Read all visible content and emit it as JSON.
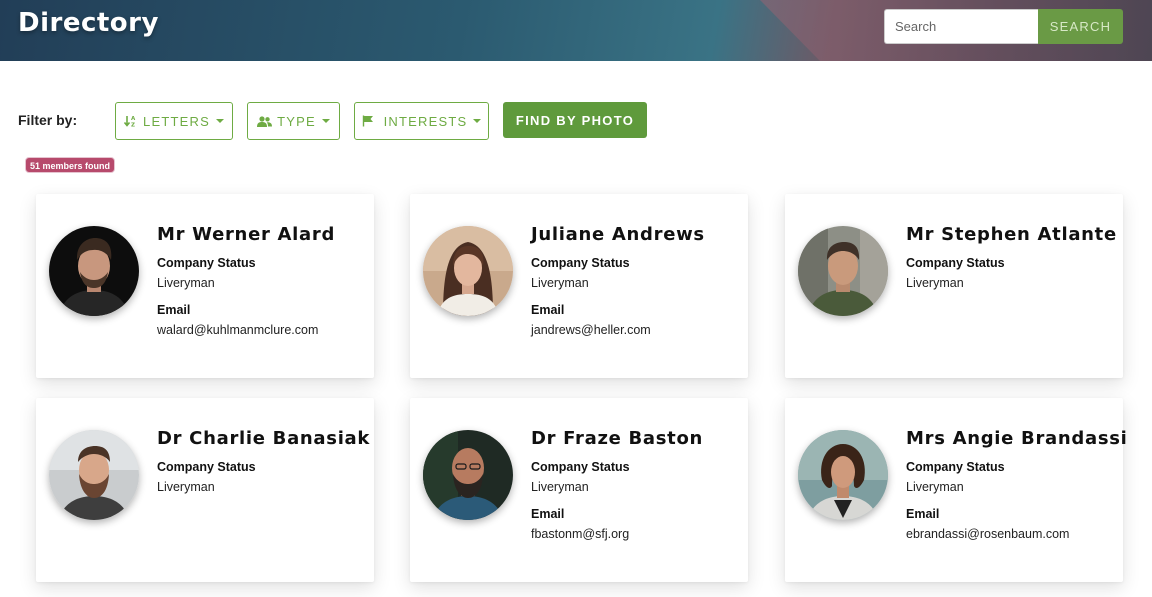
{
  "header": {
    "title": "Directory",
    "search_placeholder": "Search",
    "search_button": "SEARCH"
  },
  "filters": {
    "label": "Filter by:",
    "letters": "LETTERS",
    "type": "TYPE",
    "interests": "INTERESTS",
    "find_by_photo": "FIND BY PHOTO",
    "count": "51 members found"
  },
  "colors": {
    "accent_green": "#6eab43",
    "badge_pink": "#b74a6c"
  },
  "members": [
    {
      "name": "Mr Werner Alard",
      "status_label": "Company Status",
      "status": "Liveryman",
      "email_label": "Email",
      "email": "walard@kuhlmanmclure.com",
      "avatar": "man-beard-dark-bg"
    },
    {
      "name": "Juliane Andrews",
      "status_label": "Company Status",
      "status": "Liveryman",
      "email_label": "Email",
      "email": "jandrews@heller.com",
      "avatar": "woman-long-hair"
    },
    {
      "name": "Mr Stephen Atlante",
      "status_label": "Company Status",
      "status": "Liveryman",
      "avatar": "man-short-hair"
    },
    {
      "name": "Dr Charlie Banasiak",
      "status_label": "Company Status",
      "status": "Liveryman",
      "avatar": "man-beard-light-bg"
    },
    {
      "name": "Dr Fraze Baston",
      "status_label": "Company Status",
      "status": "Liveryman",
      "email_label": "Email",
      "email": "fbastonm@sfj.org",
      "avatar": "man-bald-beard"
    },
    {
      "name": "Mrs Angie Brandassi",
      "status_label": "Company Status",
      "status": "Liveryman",
      "email_label": "Email",
      "email": "ebrandassi@rosenbaum.com",
      "avatar": "woman-curly-hair"
    }
  ]
}
